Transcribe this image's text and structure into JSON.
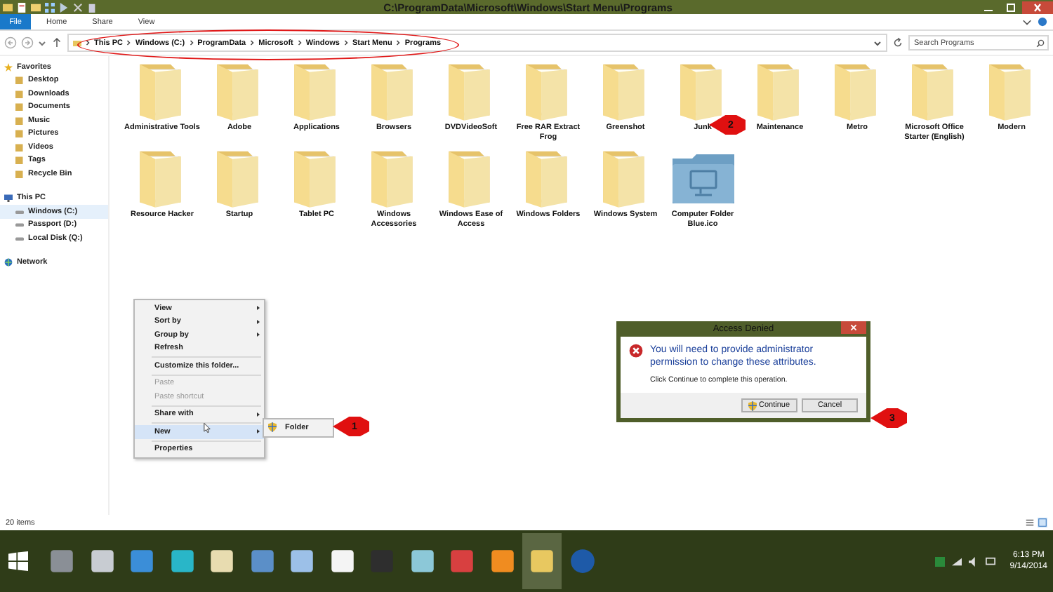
{
  "window": {
    "title": "C:\\ProgramData\\Microsoft\\Windows\\Start Menu\\Programs"
  },
  "ribbon_tabs": [
    {
      "label": "File",
      "selected": true
    },
    {
      "label": "Home",
      "selected": false
    },
    {
      "label": "Share",
      "selected": false
    },
    {
      "label": "View",
      "selected": false
    }
  ],
  "address_bar": {
    "breadcrumb": [
      "This PC",
      "Windows (C:)",
      "ProgramData",
      "Microsoft",
      "Windows",
      "Start Menu",
      "Programs"
    ],
    "search": {
      "placeholder": "Search Programs"
    }
  },
  "sidebar": {
    "groups": [
      {
        "label": "Favorites",
        "children": [
          {
            "label": "Desktop",
            "selected": false
          },
          {
            "label": "Downloads",
            "selected": false
          },
          {
            "label": "Documents",
            "selected": false
          },
          {
            "label": "Music",
            "selected": false
          },
          {
            "label": "Pictures",
            "selected": false
          },
          {
            "label": "Videos",
            "selected": false
          },
          {
            "label": "Tags",
            "selected": false
          },
          {
            "label": "Recycle Bin",
            "selected": false
          }
        ]
      },
      {
        "label": "This PC",
        "children": [
          {
            "label": "Windows (C:)",
            "selected": true
          },
          {
            "label": "Passport (D:)",
            "selected": false
          },
          {
            "label": "Local Disk (Q:)",
            "selected": false
          }
        ]
      },
      {
        "label": "Network"
      }
    ]
  },
  "items": [
    {
      "kind": "folder",
      "label": "Administrative Tools"
    },
    {
      "kind": "folder",
      "label": "Adobe"
    },
    {
      "kind": "folder",
      "label": "Applications"
    },
    {
      "kind": "folder",
      "label": "Browsers"
    },
    {
      "kind": "folder",
      "label": "DVDVideoSoft"
    },
    {
      "kind": "folder",
      "label": "Free RAR Extract Frog"
    },
    {
      "kind": "folder",
      "label": "Greenshot"
    },
    {
      "kind": "folder",
      "label": "Junk"
    },
    {
      "kind": "folder",
      "label": "Maintenance"
    },
    {
      "kind": "folder",
      "label": "Metro"
    },
    {
      "kind": "folder",
      "label": "Microsoft Office Starter (English)"
    },
    {
      "kind": "folder",
      "label": "Modern"
    },
    {
      "kind": "folder",
      "label": "Resource Hacker"
    },
    {
      "kind": "folder",
      "label": "Startup"
    },
    {
      "kind": "folder",
      "label": "Tablet PC"
    },
    {
      "kind": "folder",
      "label": "Windows Accessories"
    },
    {
      "kind": "folder",
      "label": "Windows Ease of Access"
    },
    {
      "kind": "folder",
      "label": "Windows Folders"
    },
    {
      "kind": "folder",
      "label": "Windows System"
    },
    {
      "kind": "icon-file",
      "label": "Computer Folder Blue.ico"
    }
  ],
  "context_menu": [
    {
      "kind": "item",
      "label": "View",
      "submenu": true,
      "disabled": false,
      "selected": false
    },
    {
      "kind": "item",
      "label": "Sort by",
      "submenu": true,
      "disabled": false,
      "selected": false
    },
    {
      "kind": "item",
      "label": "Group by",
      "submenu": true,
      "disabled": false,
      "selected": false
    },
    {
      "kind": "item",
      "label": "Refresh",
      "submenu": false,
      "disabled": false,
      "selected": false
    },
    {
      "kind": "separator"
    },
    {
      "kind": "item",
      "label": "Customize this folder...",
      "submenu": false,
      "disabled": false,
      "selected": false
    },
    {
      "kind": "separator"
    },
    {
      "kind": "item",
      "label": "Paste",
      "submenu": false,
      "disabled": true,
      "selected": false
    },
    {
      "kind": "item",
      "label": "Paste shortcut",
      "submenu": false,
      "disabled": true,
      "selected": false
    },
    {
      "kind": "separator"
    },
    {
      "kind": "item",
      "label": "Share with",
      "submenu": true,
      "disabled": false,
      "selected": false
    },
    {
      "kind": "separator"
    },
    {
      "kind": "item",
      "label": "New",
      "submenu": true,
      "disabled": false,
      "selected": true
    },
    {
      "kind": "separator"
    },
    {
      "kind": "item",
      "label": "Properties",
      "submenu": false,
      "disabled": false,
      "selected": false
    }
  ],
  "submenu": {
    "label": "Folder"
  },
  "dialog": {
    "title": "Access Denied",
    "heading": "You will need to provide administrator permission to change these attributes.",
    "message": "Click Continue to complete this operation.",
    "buttons": [
      {
        "label": "Continue",
        "shield": true
      },
      {
        "label": "Cancel",
        "shield": false
      }
    ]
  },
  "callouts": [
    {
      "label": "1"
    },
    {
      "label": "2"
    },
    {
      "label": "3"
    }
  ],
  "status_bar": {
    "count": "20 items"
  },
  "taskbar": {
    "apps": [
      {
        "selected": false
      },
      {
        "selected": false
      },
      {
        "selected": false
      },
      {
        "selected": false
      },
      {
        "selected": false
      },
      {
        "selected": false
      },
      {
        "selected": false
      },
      {
        "selected": false
      },
      {
        "selected": false
      },
      {
        "selected": false
      },
      {
        "selected": false
      },
      {
        "selected": false
      },
      {
        "selected": true
      },
      {
        "selected": false
      }
    ],
    "time": "6:13 PM",
    "date": "9/14/2014"
  }
}
